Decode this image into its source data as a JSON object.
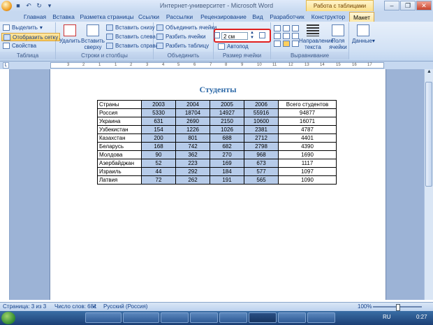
{
  "window": {
    "title": "Интернет-университет - Microsoft Word",
    "context_title": "Работа с таблицами",
    "controls": [
      "–",
      "❐",
      "✕"
    ]
  },
  "tabs": [
    {
      "label": "Главная"
    },
    {
      "label": "Вставка"
    },
    {
      "label": "Разметка страницы"
    },
    {
      "label": "Ссылки"
    },
    {
      "label": "Рассылки"
    },
    {
      "label": "Рецензирование"
    },
    {
      "label": "Вид"
    },
    {
      "label": "Разработчик"
    },
    {
      "label": "Конструктор"
    },
    {
      "label": "Макет",
      "active": true
    }
  ],
  "ribbon": {
    "table_group": {
      "label": "Таблица",
      "select": "Выделить",
      "show_grid": "Отобразить сетку",
      "properties": "Свойства"
    },
    "rows_cols_group": {
      "label": "Строки и столбцы",
      "delete": "Удалить",
      "insert_above": "Вставить сверху",
      "insert_below": "Вставить снизу",
      "insert_left": "Вставить слева",
      "insert_right": "Вставить справа"
    },
    "merge_group": {
      "label": "Объединить",
      "merge_cells": "Объединить ячейки",
      "split_cells": "Разбить ячейки",
      "split_table": "Разбить таблицу"
    },
    "size_group": {
      "label": "Размер ячейки",
      "height_value": "2 см",
      "autofit": "Автопод"
    },
    "align_group": {
      "label": "Выравнивание",
      "text_direction": "Направление текста",
      "cell_margins": "Поля ячейки"
    },
    "data_group": {
      "data": "Данные"
    }
  },
  "ruler": {
    "ticks": [
      "3",
      "2",
      "1",
      "1",
      "2",
      "3",
      "4",
      "5",
      "6",
      "7",
      "8",
      "9",
      "10",
      "11",
      "12",
      "13",
      "14",
      "15",
      "16",
      "17"
    ]
  },
  "document": {
    "title": "Студенты",
    "table": {
      "headers": [
        "Страны",
        "2003",
        "2004",
        "2005",
        "2006",
        "Всего студентов"
      ],
      "rows": [
        [
          "Россия",
          "5330",
          "18704",
          "14927",
          "55916",
          "94877"
        ],
        [
          "Украина",
          "631",
          "2690",
          "2150",
          "10600",
          "16071"
        ],
        [
          "Узбекистан",
          "154",
          "1226",
          "1026",
          "2381",
          "4787"
        ],
        [
          "Казахстан",
          "200",
          "801",
          "688",
          "2712",
          "4401"
        ],
        [
          "Беларусь",
          "168",
          "742",
          "682",
          "2798",
          "4390"
        ],
        [
          "Молдова",
          "90",
          "362",
          "270",
          "968",
          "1690"
        ],
        [
          "Азербайджан",
          "52",
          "223",
          "169",
          "673",
          "1117"
        ],
        [
          "Израиль",
          "44",
          "292",
          "184",
          "577",
          "1097"
        ],
        [
          "Латвия",
          "72",
          "262",
          "191",
          "565",
          "1090"
        ]
      ]
    }
  },
  "statusbar": {
    "page": "Страница: 3 из 3",
    "words": "Число слов: 681",
    "language": "Русский (Россия)",
    "zoom": "100%"
  },
  "taskbar": {
    "lang": "RU",
    "time": "0:27"
  }
}
